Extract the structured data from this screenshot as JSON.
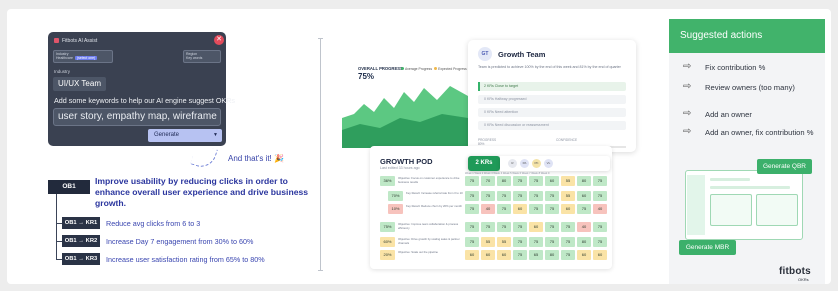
{
  "assistant": {
    "title": "Fitbots AI Assist",
    "field1_label": "Industry",
    "field1_tag": "(select one)",
    "field1_value": "Healthcare",
    "field2_label": "Region",
    "field2_value": "Key words",
    "industry_label": "Industry",
    "team": "UI/UX Team",
    "hint": "Add some keywords to help our AI engine suggest OKRs",
    "keywords": "user story, empathy map, wireframe",
    "generate_label": "Generate",
    "close_icon": "close-icon"
  },
  "thats_it": "And that's it!",
  "thats_it_emoji": "🎉",
  "okr": {
    "objective_id": "OB1",
    "objective": "Improve usability by reducing clicks in order to enhance overall user experience and drive business growth.",
    "key_results": [
      {
        "id": "OB1 → KR1",
        "text": "Reduce avg clicks from 6 to 3"
      },
      {
        "id": "OB1 → KR2",
        "text": "Increase Day 7 engagement from 30% to 60%"
      },
      {
        "id": "OB1 → KR3",
        "text": "Increase user satisfaction rating from 65% to 80%"
      }
    ]
  },
  "overall": {
    "title": "OVERALL PROGRESS",
    "value": "75%",
    "legend_a": "Average Progress",
    "legend_b": "Expected Progress"
  },
  "growth_team": {
    "initials": "GT",
    "name": "Growth Team",
    "description": "Team is predicted to achieve 100% by the end of this week and 81% by the end of quarter",
    "rows": [
      "2 KRs Close to target",
      "0 KRs Halfway progressed",
      "0 KRs Need attention",
      "0 KRs Need discussion or reassessment"
    ],
    "progress_label": "PROGRESS",
    "confidence_label": "CONFIDENCE",
    "progress_value": "80%"
  },
  "pod": {
    "title": "GROWTH POD",
    "subtitle": "Last edited 33 hours ago",
    "krs_button": "2 KRs",
    "avatars": [
      "R",
      "PA",
      "PK",
      "VL"
    ],
    "header": "Week 1  Week 2  Week 3  Week 4  Week 5  Week 6  Week 7  Week 8  Week 9",
    "rows": [
      {
        "pct": "36%",
        "status": "g",
        "label": "Objective: Focus on customer experience to drive business results",
        "values": [
          "75",
          "70",
          "80",
          "75",
          "75",
          "60",
          "55",
          "80",
          "75"
        ],
        "colors": [
          "g",
          "g",
          "g",
          "g",
          "g",
          "g",
          "y",
          "g",
          "g"
        ]
      },
      {
        "pct": "70%",
        "status": "g",
        "label": "Key Result: Increase referral rate from 3 to 10",
        "values": [
          "75",
          "75",
          "75",
          "75",
          "75",
          "75",
          "55",
          "60",
          "75"
        ],
        "colors": [
          "g",
          "g",
          "g",
          "g",
          "g",
          "g",
          "y",
          "g",
          "g"
        ]
      },
      {
        "pct": "10%",
        "status": "r",
        "label": "Key Result: Reduce churn by 20% per month",
        "values": [
          "75",
          "40",
          "75",
          "60",
          "75",
          "75",
          "60",
          "75",
          "40"
        ],
        "colors": [
          "g",
          "r",
          "g",
          "y",
          "g",
          "g",
          "y",
          "g",
          "r"
        ]
      },
      {
        "pct": "75%",
        "status": "g",
        "label": "Objective: Improve team collaboration & process efficiency",
        "values": [
          "75",
          "75",
          "75",
          "75",
          "60",
          "75",
          "75",
          "40",
          "75"
        ],
        "colors": [
          "g",
          "g",
          "g",
          "g",
          "y",
          "g",
          "g",
          "r",
          "g"
        ]
      },
      {
        "pct": "60%",
        "status": "y",
        "label": "Objective: Drive growth by scaling sales & partner channels",
        "values": [
          "75",
          "55",
          "55",
          "75",
          "75",
          "75",
          "75",
          "80",
          "75"
        ],
        "colors": [
          "g",
          "y",
          "y",
          "g",
          "g",
          "g",
          "g",
          "g",
          "g"
        ]
      },
      {
        "pct": "20%",
        "status": "y",
        "label": "Objective: Scale out the pipeline",
        "values": [
          "60",
          "60",
          "60",
          "75",
          "65",
          "80",
          "75",
          "60",
          "60"
        ],
        "colors": [
          "y",
          "y",
          "y",
          "g",
          "g",
          "g",
          "g",
          "y",
          "y"
        ]
      }
    ]
  },
  "suggestions": {
    "title": "Suggested actions",
    "items": [
      "Fix contribution %",
      "Review owners (too many)",
      "Add an owner",
      "Add an owner, fix contribution %"
    ],
    "qbr_label": "Generate QBR",
    "mbr_label": "Generate MBR"
  },
  "logo": {
    "text": "fitbots",
    "sub": "OKRs"
  },
  "colors": {
    "accent_green": "#41b36b",
    "indigo": "#2a359e",
    "panel_dark": "#3a4151"
  }
}
